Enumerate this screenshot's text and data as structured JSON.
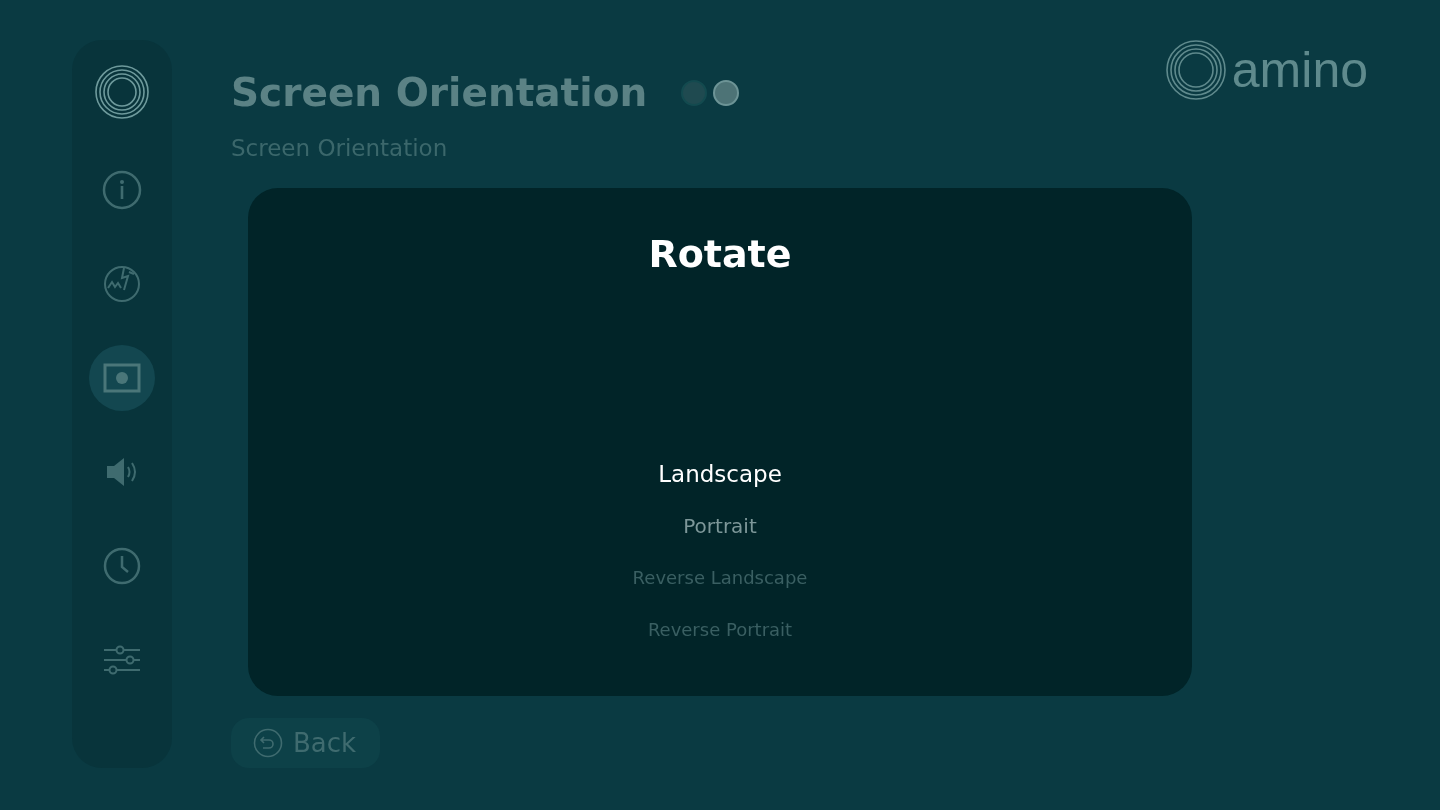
{
  "sidebar": {
    "items": [
      {
        "selected": false
      },
      {
        "selected": false
      },
      {
        "selected": true
      },
      {
        "selected": false
      },
      {
        "selected": false
      },
      {
        "selected": false
      }
    ]
  },
  "header": {
    "title": "Screen Orientation",
    "pages": [
      {
        "selected": false
      },
      {
        "selected": true
      }
    ]
  },
  "logo": {
    "text": "amino"
  },
  "section": {
    "label": "Screen Orientation"
  },
  "back_button": {
    "label": "Back"
  },
  "dialog": {
    "title": "Rotate",
    "options": [
      {
        "label": "Landscape",
        "selected": true
      },
      {
        "label": "Portrait",
        "selected": false
      },
      {
        "label": "Reverse Landscape",
        "selected": false
      },
      {
        "label": "Reverse Portrait",
        "selected": false
      }
    ]
  }
}
